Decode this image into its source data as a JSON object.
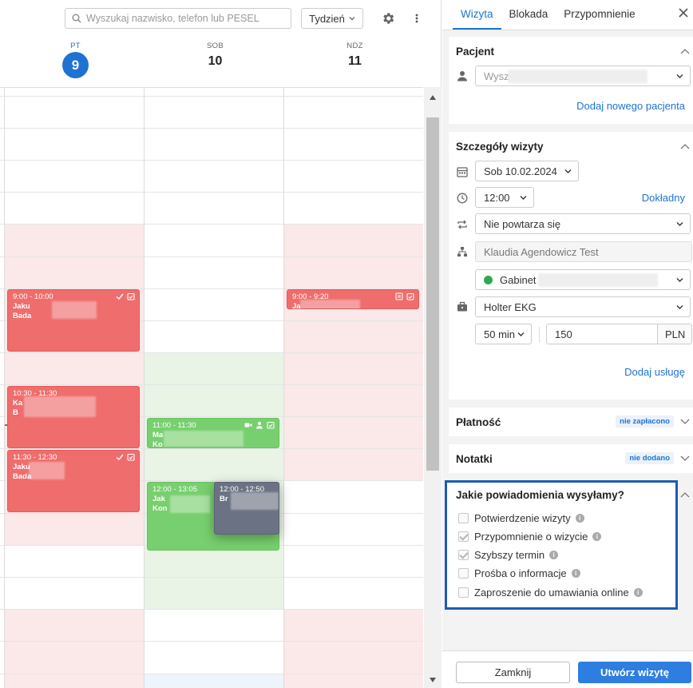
{
  "search": {
    "placeholder": "Wyszukaj nazwisko, telefon lub PESEL"
  },
  "view_select": {
    "label": "Tydzień"
  },
  "days": [
    {
      "name": "PT",
      "num": "9"
    },
    {
      "name": "SOB",
      "num": "10"
    },
    {
      "name": "NDZ",
      "num": "11"
    }
  ],
  "events": [
    {
      "time": "9:00 - 10:00",
      "line1": "Jaku",
      "line2": "Bada"
    },
    {
      "time": "10:30 - 11:30",
      "line1": "Ka",
      "line2": "B"
    },
    {
      "time": "11:30 - 12:30",
      "line1": "Jaku",
      "line2": "Bada"
    },
    {
      "time": "11:00 - 11:30",
      "line1": "Ma",
      "line2": "Ko"
    },
    {
      "time": "12:00 - 13:05",
      "line1": "Jak",
      "line2": "Kon"
    },
    {
      "time": "12:00 - 12:50",
      "line1": "Br",
      "line2": ""
    },
    {
      "time": "9:00 - 9:20",
      "line1": "Ja",
      "line2": ""
    }
  ],
  "tabs": [
    "Wizyta",
    "Blokada",
    "Przypomnienie"
  ],
  "patient": {
    "title": "Pacjent",
    "input_value": "Wysz",
    "add_link": "Dodaj nowego pacjenta"
  },
  "details": {
    "title": "Szczegóły wizyty",
    "date": "Sob 10.02.2024",
    "time": "12:00",
    "exact_link": "Dokładny",
    "repeat": "Nie powtarza się",
    "doctor": "Klaudia Agendowicz Test",
    "room": "Gabinet",
    "service": "Holter EKG",
    "duration": "50 min",
    "price": "150",
    "currency": "PLN",
    "add_service_link": "Dodaj usługę"
  },
  "payment": {
    "title": "Płatność",
    "badge": "nie zapłacono"
  },
  "notes": {
    "title": "Notatki",
    "badge": "nie dodano"
  },
  "notifications": {
    "title": "Jakie powiadomienia wysyłamy?",
    "items": [
      {
        "label": "Potwierdzenie wizyty",
        "checked": false
      },
      {
        "label": "Przypomnienie o wizycie",
        "checked": true
      },
      {
        "label": "Szybszy termin",
        "checked": true
      },
      {
        "label": "Prośba o informacje",
        "checked": false
      },
      {
        "label": "Zaproszenie do umawiania online",
        "checked": false
      }
    ]
  },
  "footer": {
    "close": "Zamknij",
    "create": "Utwórz wizytę"
  },
  "colors": {
    "accent": "#1e73d2",
    "event_red": "#ef6d6d",
    "event_green": "#78cf6f",
    "event_gray": "#6b7283",
    "focus_border": "#1f5bb5"
  }
}
